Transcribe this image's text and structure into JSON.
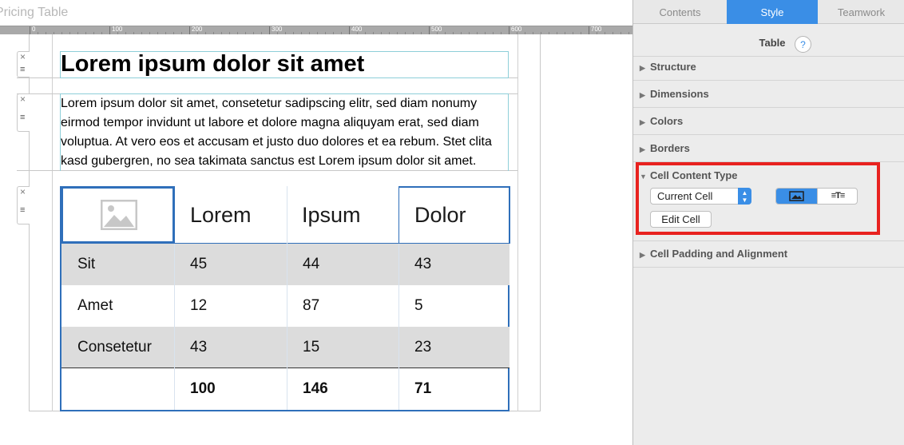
{
  "doc": {
    "title": "Pricing Table"
  },
  "ruler": {
    "labels": [
      "0",
      "100",
      "200",
      "300",
      "400",
      "500",
      "600",
      "700"
    ]
  },
  "heading": "Lorem ipsum dolor sit amet",
  "paragraph": "Lorem ipsum dolor sit amet, consetetur sadipscing elitr, sed diam nonumy eirmod tempor invidunt ut labore et dolore magna aliquyam erat, sed diam voluptua. At vero eos et accusam et justo duo dolores et ea rebum. Stet clita kasd gubergren, no sea takimata sanctus est Lorem ipsum dolor sit amet.",
  "table": {
    "headers": [
      "Lorem",
      "Ipsum",
      "Dolor"
    ],
    "rows": [
      {
        "label": "Sit",
        "values": [
          "45",
          "44",
          "43"
        ]
      },
      {
        "label": "Amet",
        "values": [
          "12",
          "87",
          "5"
        ]
      },
      {
        "label": "Consetetur",
        "values": [
          "43",
          "15",
          "23"
        ]
      }
    ],
    "totals": [
      "100",
      "146",
      "71"
    ]
  },
  "inspector": {
    "tabs": [
      {
        "label": "Contents",
        "active": false
      },
      {
        "label": "Style",
        "active": true
      },
      {
        "label": "Teamwork",
        "active": false
      }
    ],
    "title": "Table",
    "help": "?",
    "sections": {
      "structure": "Structure",
      "dimensions": "Dimensions",
      "colors": "Colors",
      "borders": "Borders",
      "cell_content_type": "Cell Content Type",
      "cell_padding": "Cell Padding and Alignment"
    },
    "cell_select": {
      "value": "Current Cell"
    },
    "content_type_options": [
      "image",
      "text"
    ],
    "edit_cell": "Edit Cell",
    "accent_color": "#3a8ee6",
    "highlight_color": "#e8221f"
  }
}
